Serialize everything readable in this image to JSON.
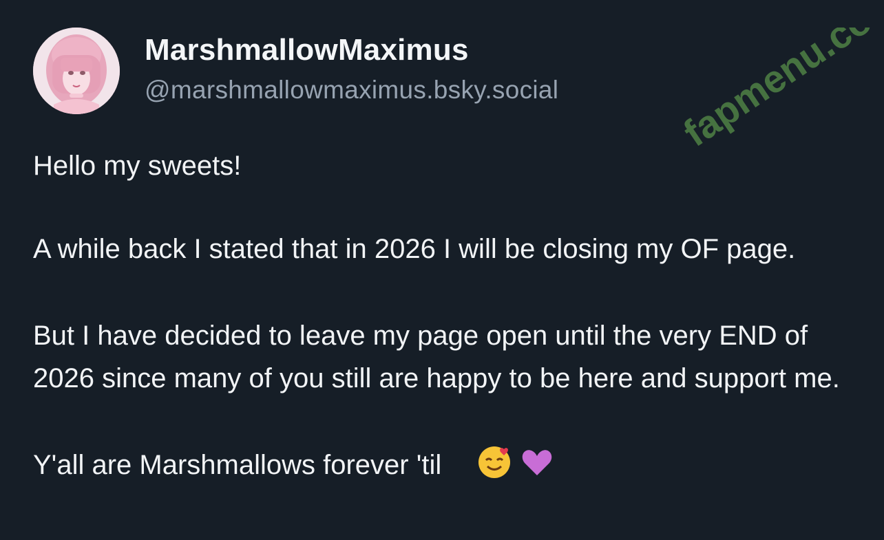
{
  "post": {
    "author": {
      "display_name": "MarshmallowMaximus",
      "handle": "@marshmallowmaximus.bsky.social"
    },
    "paragraphs": [
      "Hello my sweets!",
      "A while back I stated that in 2026 I will be closing my OF page.",
      "But I have decided to leave my page open until the very END of 2026 since many of you still are happy to be here and support me.",
      "Y'all are Marshmallows forever 'til"
    ],
    "emojis": [
      "smiling-face-with-hearts",
      "purple-heart"
    ]
  },
  "watermark": {
    "text": "fapmenu.com",
    "color": "#4b7b44"
  },
  "colors": {
    "background": "#161e27",
    "text": "#f2f4f6",
    "handle": "#97a3b1"
  }
}
